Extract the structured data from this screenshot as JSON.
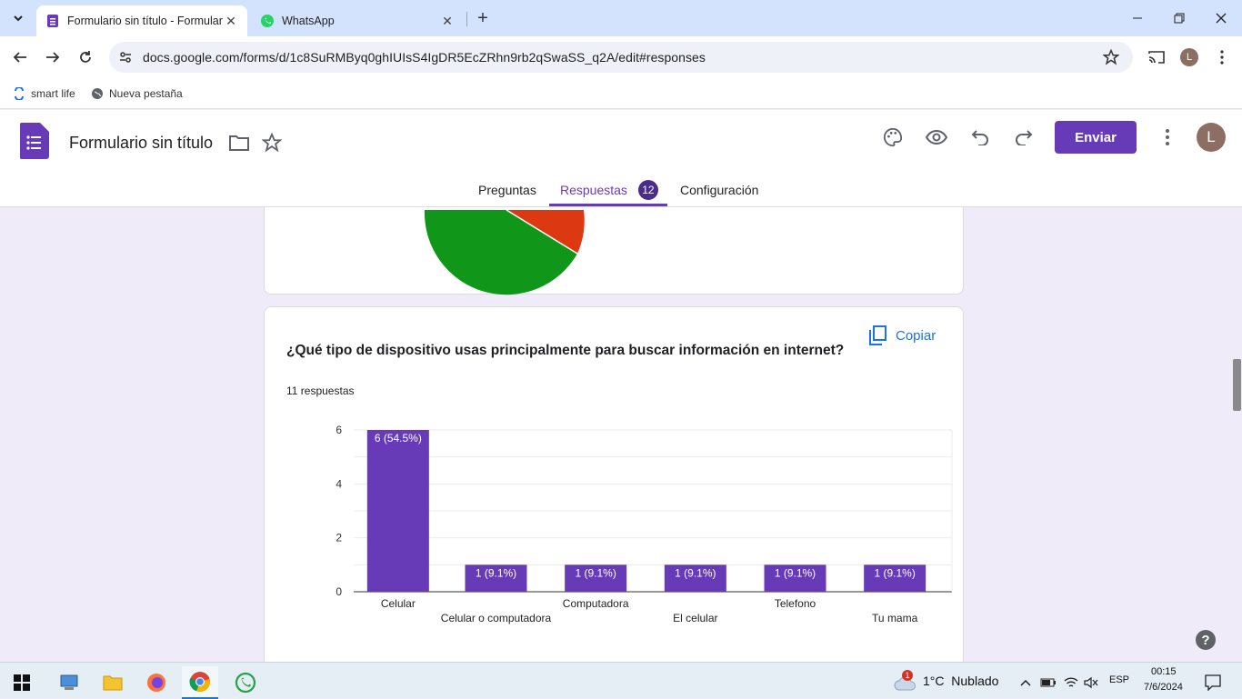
{
  "browser": {
    "tabs": [
      {
        "title": "Formulario sin título - Formular",
        "active": true
      },
      {
        "title": "WhatsApp",
        "active": false
      }
    ],
    "url": "docs.google.com/forms/d/1c8SuRMByq0ghIUIsS4IgDR5EcZRhn9rb2qSwaSS_q2A/edit#responses",
    "profile_initial": "L",
    "bookmarks": [
      {
        "label": "smart life",
        "icon": "smartlife-icon"
      },
      {
        "label": "Nueva pestaña",
        "icon": "globe-icon"
      }
    ]
  },
  "form": {
    "title": "Formulario sin título",
    "send_label": "Enviar",
    "avatar_initial": "L",
    "tabs": [
      {
        "label": "Preguntas"
      },
      {
        "label": "Respuestas",
        "badge": "12"
      },
      {
        "label": "Configuración"
      }
    ]
  },
  "question": {
    "title": "¿Qué tipo de dispositivo usas principalmente para buscar información en internet?",
    "count": "11 respuestas",
    "copy_label": "Copiar"
  },
  "chart_data": {
    "type": "bar",
    "categories": [
      "Celular",
      "Celular o computadora",
      "Computadora",
      "El celular",
      "Telefono",
      "Tu mama"
    ],
    "values": [
      6,
      1,
      1,
      1,
      1,
      1
    ],
    "data_labels": [
      "6 (54.5%)",
      "1 (9.1%)",
      "1 (9.1%)",
      "1 (9.1%)",
      "1 (9.1%)",
      "1 (9.1%)"
    ],
    "ylim": [
      0,
      6
    ],
    "yticks": [
      0,
      2,
      4,
      6
    ],
    "grid": true,
    "bar_color": "#673ab7"
  },
  "taskbar": {
    "weather": "1°C  Nublado",
    "weather_badge": "1",
    "lang": "ESP",
    "time": "00:15",
    "date": "7/6/2024"
  },
  "colors": {
    "accent": "#673ab7",
    "background": "#f0ebf8",
    "pie_green": "#109618",
    "pie_red": "#dc3912"
  }
}
